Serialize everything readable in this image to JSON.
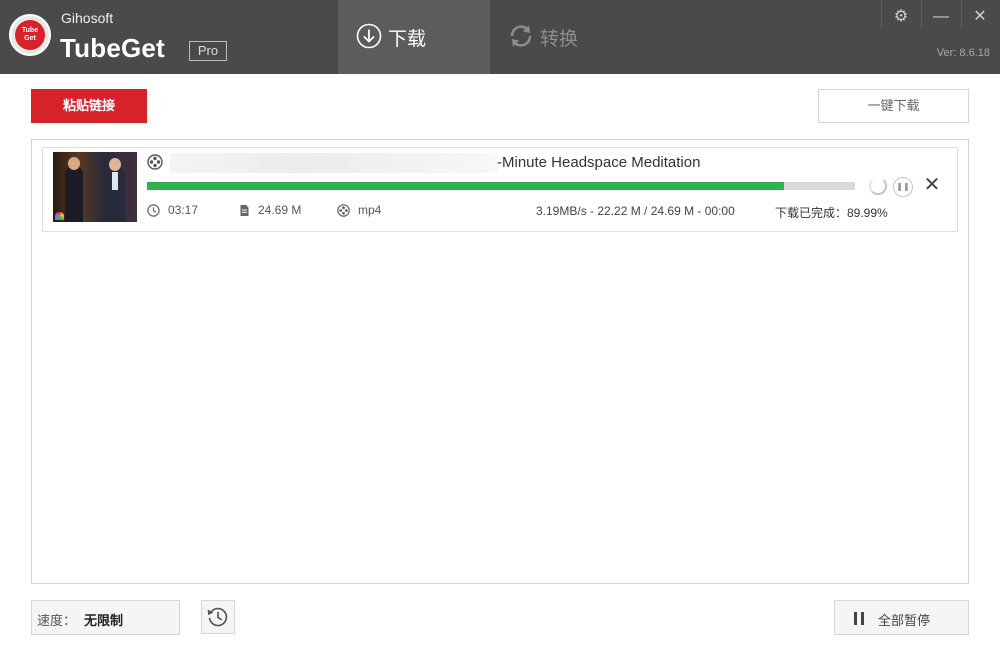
{
  "app": {
    "company": "Gihosoft",
    "name": "TubeGet",
    "badge": "Pro",
    "logo_text_line1": "Tube",
    "logo_text_line2": "Get",
    "version": "Ver: 8.6.18"
  },
  "tabs": [
    {
      "label": "下载",
      "icon": "download-circle-icon",
      "active": true
    },
    {
      "label": "转换",
      "icon": "refresh-icon",
      "active": false
    }
  ],
  "window_controls": {
    "settings": "⚙",
    "minimize": "—",
    "close": "✕"
  },
  "toolbar": {
    "paste_label": "粘贴链接",
    "onekey_label": "一键下载"
  },
  "downloads": [
    {
      "title": "-Minute Headspace Meditation",
      "progress_percent": 89.99,
      "duration": "03:17",
      "size": "24.69 M",
      "format": "mp4",
      "stats": "3.19MB/s - 22.22 M / 24.69 M - 00:00",
      "status": "下载已完成：89.99%"
    }
  ],
  "footer": {
    "speed_label": "速度：",
    "speed_value": "无限制",
    "pause_all_label": "全部暂停"
  },
  "colors": {
    "header_bg": "#4a4a4a",
    "accent_red": "#d8222a",
    "progress_green": "#2fb14b"
  }
}
